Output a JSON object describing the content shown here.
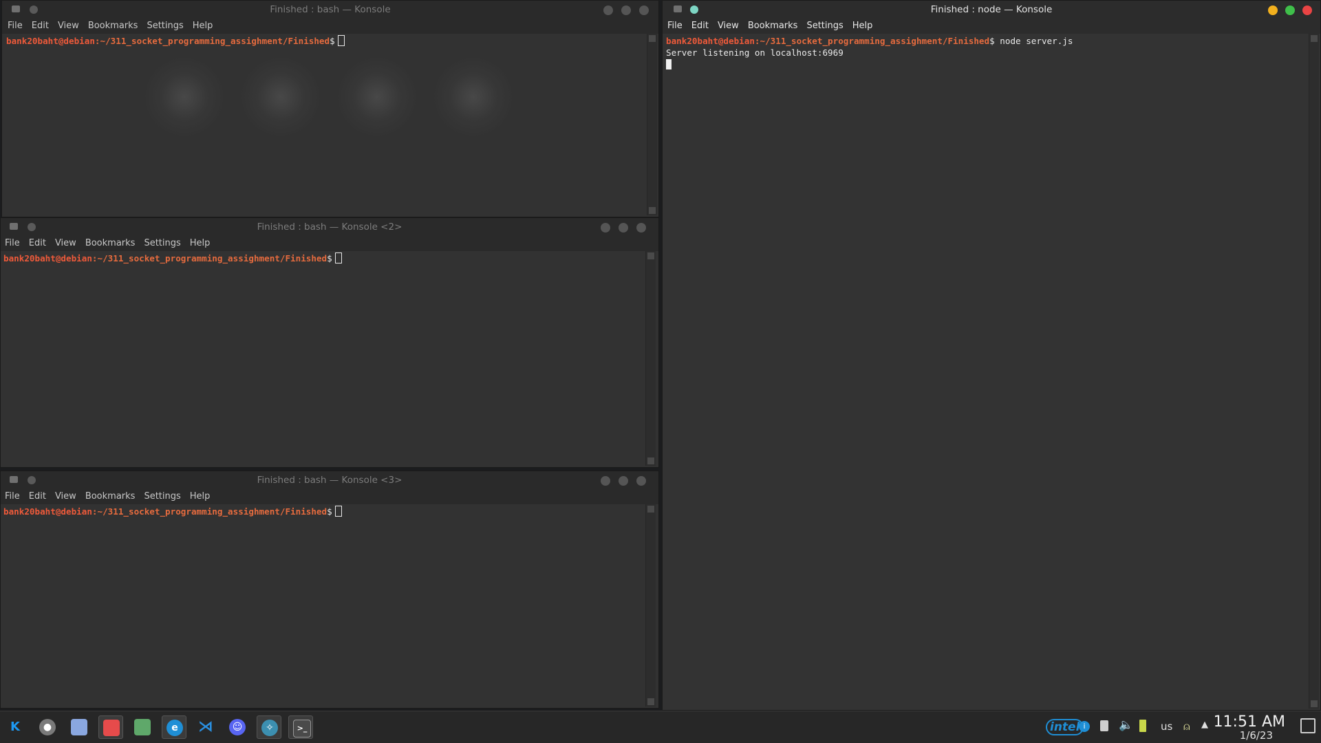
{
  "windows": {
    "w1": {
      "title": "Finished : bash — Konsole",
      "menu": [
        "File",
        "Edit",
        "View",
        "Bookmarks",
        "Settings",
        "Help"
      ],
      "prompt_user": "bank20baht@debian",
      "prompt_path": ":~/311_socket_programming_assighment/Finished",
      "prompt_symbol": "$"
    },
    "w2": {
      "title": "Finished : bash — Konsole <2>",
      "menu": [
        "File",
        "Edit",
        "View",
        "Bookmarks",
        "Settings",
        "Help"
      ],
      "prompt_user": "bank20baht@debian",
      "prompt_path": ":~/311_socket_programming_assighment/Finished",
      "prompt_symbol": "$"
    },
    "w3": {
      "title": "Finished : bash — Konsole <3>",
      "menu": [
        "File",
        "Edit",
        "View",
        "Bookmarks",
        "Settings",
        "Help"
      ],
      "prompt_user": "bank20baht@debian",
      "prompt_path": ":~/311_socket_programming_assighment/Finished",
      "prompt_symbol": "$"
    },
    "w4": {
      "title": "Finished : node — Konsole",
      "menu": [
        "File",
        "Edit",
        "View",
        "Bookmarks",
        "Settings",
        "Help"
      ],
      "prompt_user": "bank20baht@debian",
      "prompt_path": ":~/311_socket_programming_assighment/Finished",
      "prompt_symbol": "$",
      "command": " node server.js",
      "output": "Server listening on localhost:6969"
    }
  },
  "taskbar": {
    "launchers": [
      {
        "icon": "kde-app-launcher-icon",
        "color": "#1d99f3"
      },
      {
        "icon": "settings-icon",
        "color": "#8a8a8a"
      },
      {
        "icon": "discover-store-icon",
        "color": "#8aa7e0"
      },
      {
        "icon": "file-manager-icon",
        "color": "#e64b4b"
      },
      {
        "icon": "terminal-green-icon",
        "color": "#5fa86a"
      },
      {
        "icon": "edge-browser-icon",
        "color": "#1f8fd6"
      },
      {
        "icon": "vscode-icon",
        "color": "#2a8fe0"
      },
      {
        "icon": "discord-icon",
        "color": "#5865f2"
      },
      {
        "icon": "kde-connect-icon",
        "color": "#3c8fb0"
      },
      {
        "icon": "konsole-icon",
        "color": "#5a5a5a"
      }
    ],
    "tray": {
      "intel_label": "intel",
      "keyboard_layout": "us",
      "time": "11:51 AM",
      "date": "1/6/23"
    }
  }
}
